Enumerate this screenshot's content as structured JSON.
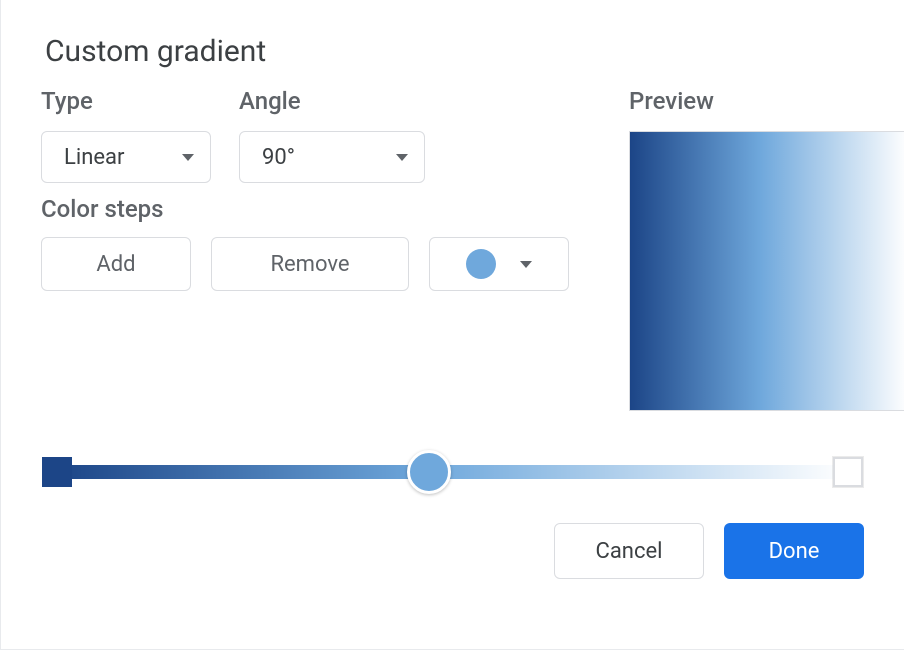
{
  "title": "Custom gradient",
  "labels": {
    "type": "Type",
    "angle": "Angle",
    "preview": "Preview",
    "color_steps": "Color steps"
  },
  "controls": {
    "type_value": "Linear",
    "angle_value": "90°",
    "add": "Add",
    "remove": "Remove",
    "swatch_color": "#6fa8dc"
  },
  "gradient": {
    "angle_deg": 90,
    "stops": [
      {
        "offset": 0.0,
        "color": "#1c4587"
      },
      {
        "offset": 0.47,
        "color": "#6fa8dc"
      },
      {
        "offset": 1.0,
        "color": "#ffffff"
      }
    ],
    "selected_stop": 1
  },
  "footer": {
    "cancel": "Cancel",
    "done": "Done"
  }
}
